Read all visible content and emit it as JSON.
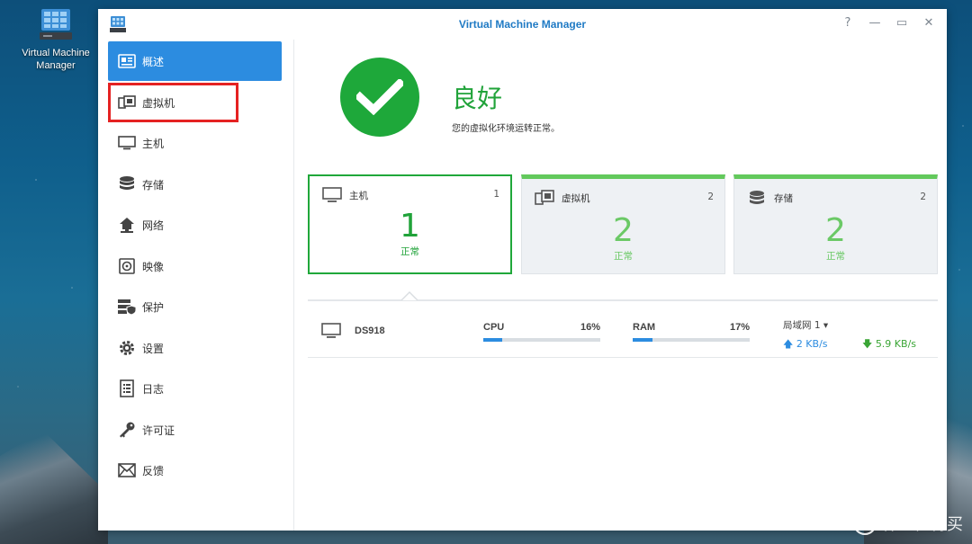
{
  "desktop": {
    "icon_label_line1": "Virtual Machine",
    "icon_label_line2": "Manager"
  },
  "window": {
    "title": "Virtual Machine Manager",
    "controls": {
      "help": "?",
      "minimize": "—",
      "maximize": "▭",
      "close": "✕"
    }
  },
  "sidebar": {
    "items": [
      {
        "label": "概述",
        "icon": "overview-icon",
        "active": true
      },
      {
        "label": "虚拟机",
        "icon": "virtual-machine-icon",
        "highlighted": true
      },
      {
        "label": "主机",
        "icon": "host-monitor-icon"
      },
      {
        "label": "存储",
        "icon": "storage-icon"
      },
      {
        "label": "网络",
        "icon": "network-icon"
      },
      {
        "label": "映像",
        "icon": "image-disc-icon"
      },
      {
        "label": "保护",
        "icon": "protection-icon"
      },
      {
        "label": "设置",
        "icon": "gear-icon"
      },
      {
        "label": "日志",
        "icon": "log-icon"
      },
      {
        "label": "许可证",
        "icon": "key-icon"
      },
      {
        "label": "反馈",
        "icon": "mail-icon"
      }
    ]
  },
  "status": {
    "title": "良好",
    "description": "您的虚拟化环境运转正常。"
  },
  "cards": [
    {
      "name": "主机",
      "count": "1",
      "big": "1",
      "state": "正常"
    },
    {
      "name": "虚拟机",
      "count": "2",
      "big": "2",
      "state": "正常"
    },
    {
      "name": "存储",
      "count": "2",
      "big": "2",
      "state": "正常"
    }
  ],
  "host_row": {
    "name": "DS918",
    "cpu_label": "CPU",
    "cpu_value": "16%",
    "cpu_fraction": 0.16,
    "ram_label": "RAM",
    "ram_value": "17%",
    "ram_fraction": 0.17,
    "network_label": "局域网 1 ▾",
    "upload": "2 KB/s",
    "download": "5.9 KB/s"
  },
  "colors": {
    "accent_blue": "#2c8ce0",
    "status_green": "#21a33a",
    "light_green": "#6bc966",
    "highlight_red": "#e52222"
  },
  "watermark": {
    "badge": "值",
    "text": "什么值得买"
  }
}
